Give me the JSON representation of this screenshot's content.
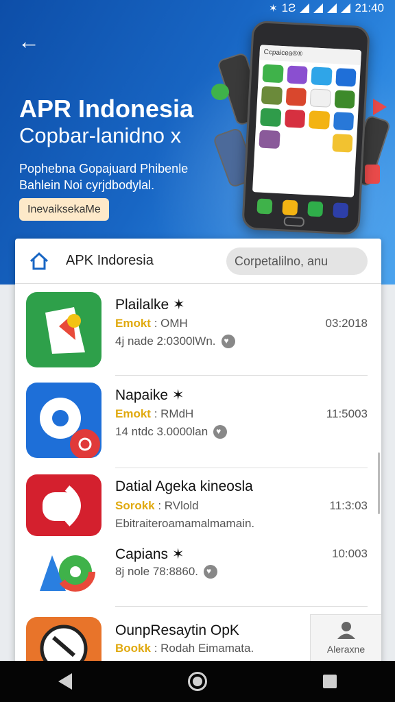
{
  "status_bar": {
    "bluetooth": "✶",
    "signal_text": "1Ƨ",
    "time": "21:40"
  },
  "hero": {
    "back_icon": "←",
    "title": "APR Indonesia",
    "subtitle": "Copbar-lanidno x",
    "description": "Pophebna Gopajuard Phibenle Bahlein Noi cyrjdbodylal.",
    "cta_label": "InevaiksekaMe",
    "phone_screen_label": "Ccpaicea®®"
  },
  "card": {
    "title": "APK Indoresia",
    "search_placeholder": "Corpetalilno, anu"
  },
  "apps": [
    {
      "name": "Plailalke ✶",
      "tag": "Emokt",
      "meta_rest": " : OMH",
      "sub": "4j nade 2:0300lWn.",
      "time": "03:2018",
      "has_heart": true
    },
    {
      "name": "Napaike ✶",
      "tag": "Emokt",
      "meta_rest": " : RMdH",
      "sub": "14 ntdc 3.0000lan",
      "time": "11:5003",
      "has_heart": true
    },
    {
      "name": "Datial Ageka kineosla",
      "tag": "Sorokk",
      "meta_rest": " : RVlold",
      "sub": "Ebitraiteroamamalmamain.",
      "time": "11:3:03",
      "has_heart": false
    },
    {
      "name": "Capians ✶",
      "tag": "",
      "meta_rest": "",
      "sub": "8j nole 78:8860.",
      "time": "10:003",
      "has_heart": true
    },
    {
      "name": "OunpResaytin OpK",
      "tag": "Bookk",
      "meta_rest": " : Rodah Eimamata.",
      "sub": "",
      "time": "",
      "has_heart": false
    }
  ],
  "floating_action": {
    "label": "Aleraxne"
  },
  "colors": {
    "primary": "#1866c4",
    "tag_yellow": "#e0a90f",
    "nav_bg": "#050505"
  }
}
